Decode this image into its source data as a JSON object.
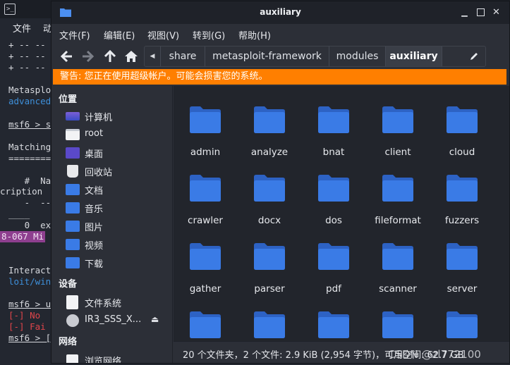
{
  "terminal": {
    "icon": "terminal-icon",
    "menu": [
      "文件",
      "动"
    ],
    "lines": [
      "+ -- --",
      "+ -- --",
      "+ -- --",
      "",
      "Metasplo",
      "advanced",
      "",
      "msf6 > s",
      "",
      "Matching",
      "========",
      "",
      "   #  Na",
      "cription",
      "   -  --",
      "____",
      "   0  ex",
      "8-067 Mi",
      "",
      "",
      "Interact",
      "loit/win",
      "",
      "msf6 > u",
      "[-] No",
      "[-] Fai",
      "msf6 > [",
      ""
    ]
  },
  "window": {
    "title": "auxiliary",
    "app_icon": "folder-icon"
  },
  "menubar": [
    "文件(F)",
    "编辑(E)",
    "视图(V)",
    "转到(G)",
    "帮助(H)"
  ],
  "toolbar": {
    "back_icon": "arrow-left-icon",
    "forward_icon": "arrow-right-icon",
    "up_icon": "arrow-up-icon",
    "home_icon": "home-icon",
    "crumb_arrow_icon": "caret-left-icon",
    "edit_icon": "pencil-icon",
    "breadcrumbs": [
      "share",
      "metasploit-framework",
      "modules",
      "auxiliary"
    ]
  },
  "warning": "警告: 您正在使用超级帐户。可能会损害您的系统。",
  "sidebar": {
    "places_title": "位置",
    "places": [
      {
        "label": "计算机",
        "icon": "computer-icon"
      },
      {
        "label": "root",
        "icon": "home-folder-icon"
      },
      {
        "label": "桌面",
        "icon": "desktop-icon"
      },
      {
        "label": "回收站",
        "icon": "trash-icon"
      },
      {
        "label": "文档",
        "icon": "documents-icon"
      },
      {
        "label": "音乐",
        "icon": "music-icon"
      },
      {
        "label": "图片",
        "icon": "pictures-icon"
      },
      {
        "label": "视频",
        "icon": "videos-icon"
      },
      {
        "label": "下载",
        "icon": "downloads-icon"
      }
    ],
    "devices_title": "设备",
    "devices": [
      {
        "label": "文件系统",
        "icon": "filesystem-icon"
      },
      {
        "label": "IR3_SSS_X...",
        "icon": "optical-disc-icon"
      }
    ],
    "network_title": "网络",
    "network": [
      {
        "label": "浏览网络",
        "icon": "network-icon"
      }
    ]
  },
  "folders": [
    "admin",
    "analyze",
    "bnat",
    "client",
    "cloud",
    "crawler",
    "docx",
    "dos",
    "fileformat",
    "fuzzers",
    "gather",
    "parser",
    "pdf",
    "scanner",
    "server",
    "",
    "",
    "",
    "",
    ""
  ],
  "status": "20 个文件夹，2 个文件: 2.9 KiB (2,954 字节)，可用空间: 62.7 GB",
  "watermark": "CSDN @zl772100",
  "colors": {
    "folder_blue": "#3a7be6",
    "warning_orange": "#ff7f00",
    "terminal_blue": "#3e8fd9",
    "terminal_red": "#e0454b"
  }
}
